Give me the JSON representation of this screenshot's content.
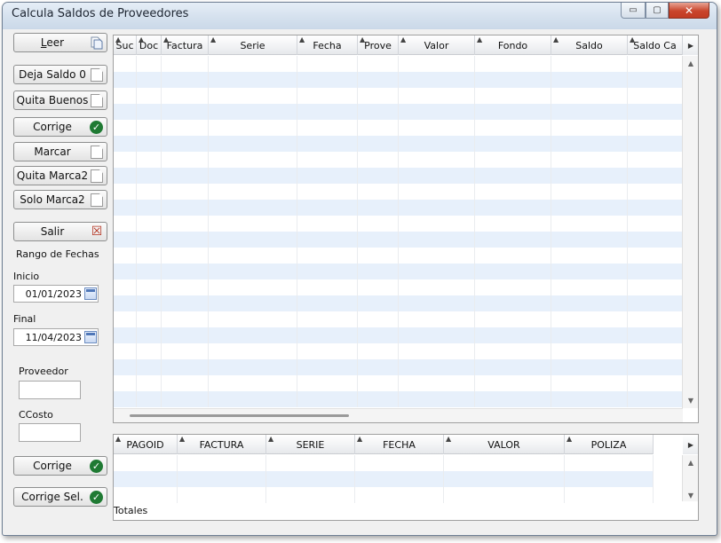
{
  "window": {
    "title": "Calcula Saldos de Proveedores",
    "controls": {
      "minimize": "▭",
      "maximize": "▢",
      "close": "✕"
    }
  },
  "sidebar": {
    "buttons": [
      {
        "label": "Leer",
        "icon": "document-copy-icon"
      },
      {
        "label": "Deja Saldo 0",
        "icon": "document-icon"
      },
      {
        "label": "Quita Buenos",
        "icon": "document-icon"
      },
      {
        "label": "Corrige",
        "icon": "check-icon"
      },
      {
        "label": "Marcar",
        "icon": "document-icon"
      },
      {
        "label": "Quita Marca2",
        "icon": "document-icon"
      },
      {
        "label": "Solo Marca2",
        "icon": "document-icon"
      },
      {
        "label": "Salir",
        "icon": "close-icon"
      }
    ],
    "date_range": {
      "title": "Rango de Fechas",
      "inicio_label": "Inicio",
      "inicio_value": "01/01/2023",
      "final_label": "Final",
      "final_value": "11/04/2023"
    },
    "proveedor_label": "Proveedor",
    "proveedor_value": "",
    "ccosto_label": "CCosto",
    "ccosto_value": "",
    "bottom_buttons": [
      {
        "label": "Corrige",
        "icon": "check-icon"
      },
      {
        "label": "Corrige Sel.",
        "icon": "check-icon"
      }
    ]
  },
  "main_grid": {
    "columns": [
      "Suc",
      "Doc",
      "Factura",
      "Serie",
      "Fecha",
      "Prove",
      "Valor",
      "Fondo",
      "Saldo",
      "Saldo Ca"
    ],
    "rows": []
  },
  "detail_grid": {
    "columns": [
      "PAGOID",
      "FACTURA",
      "SERIE",
      "FECHA",
      "VALOR",
      "POLIZA"
    ],
    "rows": [],
    "footer_label": "Totales"
  },
  "colors": {
    "row_alt": "#e7f0fb",
    "check_green": "#1f7a33",
    "close_red": "#c23b22"
  }
}
